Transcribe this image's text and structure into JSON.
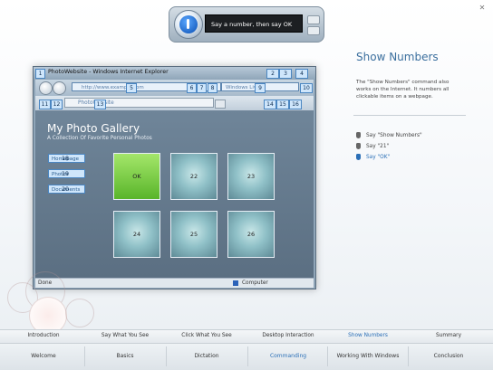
{
  "speech": {
    "prompt": "Say a number, then say OK",
    "close_glyph": "✕",
    "accent": "#0a4fb3"
  },
  "panel": {
    "title": "Show Numbers",
    "description": "The \"Show Numbers\" command also works on the Internet. It numbers all clickable items on a webpage.",
    "steps": [
      "Say \"Show Numbers\"",
      "Say \"21\"",
      "Say \"OK\""
    ],
    "active_step": 2,
    "accent": "#3b6f9e"
  },
  "browser": {
    "title": "PhotoWebsite - Windows Internet Explorer",
    "address": "http://www.example.com",
    "search": "Windows Live",
    "tab": "PhotoWebsite",
    "status_left": "Done",
    "status_right": "Computer",
    "badges": {
      "n1": "1",
      "n2": "2",
      "n3": "3",
      "n4": "4",
      "n5": "5",
      "n6": "6",
      "n7": "7",
      "n8": "8",
      "n9": "9",
      "n10": "10",
      "n11": "11",
      "n12": "12",
      "n13": "13",
      "n14": "14",
      "n15": "15",
      "n16": "16"
    }
  },
  "page": {
    "title": "My Photo Gallery",
    "subtitle": "A Collection Of Favorite Personal Photos",
    "links": [
      {
        "label": "Homepage",
        "badge": "18"
      },
      {
        "label": "Photos",
        "badge": "19"
      },
      {
        "label": "Documents",
        "badge": "20"
      }
    ],
    "thumbs": [
      "OK",
      "22",
      "23",
      "24",
      "25",
      "26"
    ],
    "selected_thumb": 0
  },
  "nav_top": [
    "Introduction",
    "Say What You See",
    "Click What You See",
    "Desktop Interaction",
    "Show Numbers",
    "Summary"
  ],
  "nav_top_active": 4,
  "nav_bottom": [
    "Welcome",
    "Basics",
    "Dictation",
    "Commanding",
    "Working With Windows",
    "Conclusion"
  ],
  "nav_bottom_active": 3,
  "colors": {
    "active": "#2a6fb7",
    "highlight": "#cfe6fb"
  }
}
